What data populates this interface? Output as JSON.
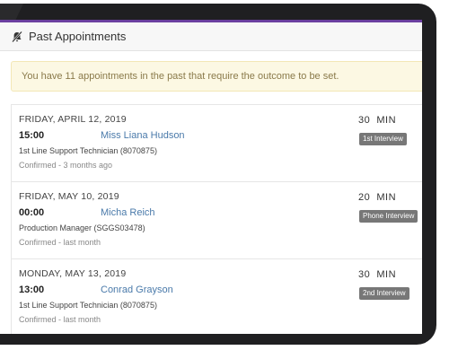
{
  "panel": {
    "title": "Past Appointments",
    "icon": "bell-slash-icon"
  },
  "alert": {
    "message": "You have 11 appointments in the past that require the outcome to be set."
  },
  "appointments": [
    {
      "date": "FRIDAY, APRIL 12, 2019",
      "time": "15:00",
      "name": "Miss Liana Hudson",
      "role": "1st Line Support Technician (8070875)",
      "status": "Confirmed - 3 months ago",
      "duration": "30  MIN",
      "type": "1st Interview"
    },
    {
      "date": "FRIDAY, MAY 10, 2019",
      "time": "00:00",
      "name": "Micha Reich",
      "role": "Production Manager (SGGS03478)",
      "status": "Confirmed - last month",
      "duration": "20  MIN",
      "type": "Phone Interview"
    },
    {
      "date": "MONDAY, MAY 13, 2019",
      "time": "13:00",
      "name": "Conrad Grayson",
      "role": "1st Line Support Technician (8070875)",
      "status": "Confirmed - last month",
      "duration": "30  MIN",
      "type": "2nd Interview"
    }
  ],
  "colors": {
    "accent": "#6b3fa0",
    "link": "#4a7aaa",
    "badge": "#777777",
    "alert_bg": "#fcf8e3"
  }
}
